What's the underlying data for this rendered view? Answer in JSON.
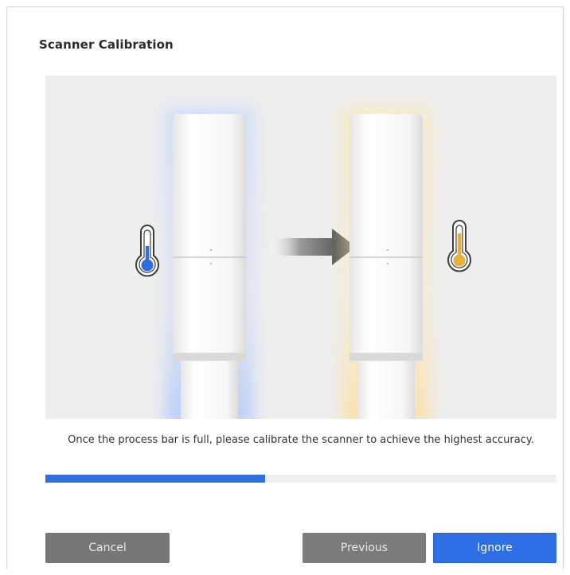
{
  "dialog": {
    "title": "Scanner Calibration",
    "message": "Once the process bar is full, please calibrate the scanner to achieve the highest accuracy.",
    "progress_fraction": 0.43,
    "buttons": {
      "cancel": "Cancel",
      "previous": "Previous",
      "ignore": "Ignore"
    }
  },
  "illustration": {
    "cold_thermometer_icon": "thermometer-cold-icon",
    "warm_thermometer_icon": "thermometer-warm-icon",
    "arrow_icon": "arrow-right-icon",
    "colors": {
      "cold": "#2f6ee0",
      "warm": "#e8b13a",
      "cold_glow": "#a9c6ff",
      "warm_glow": "#ffe6a6",
      "accent": "#2e6fe6"
    }
  }
}
